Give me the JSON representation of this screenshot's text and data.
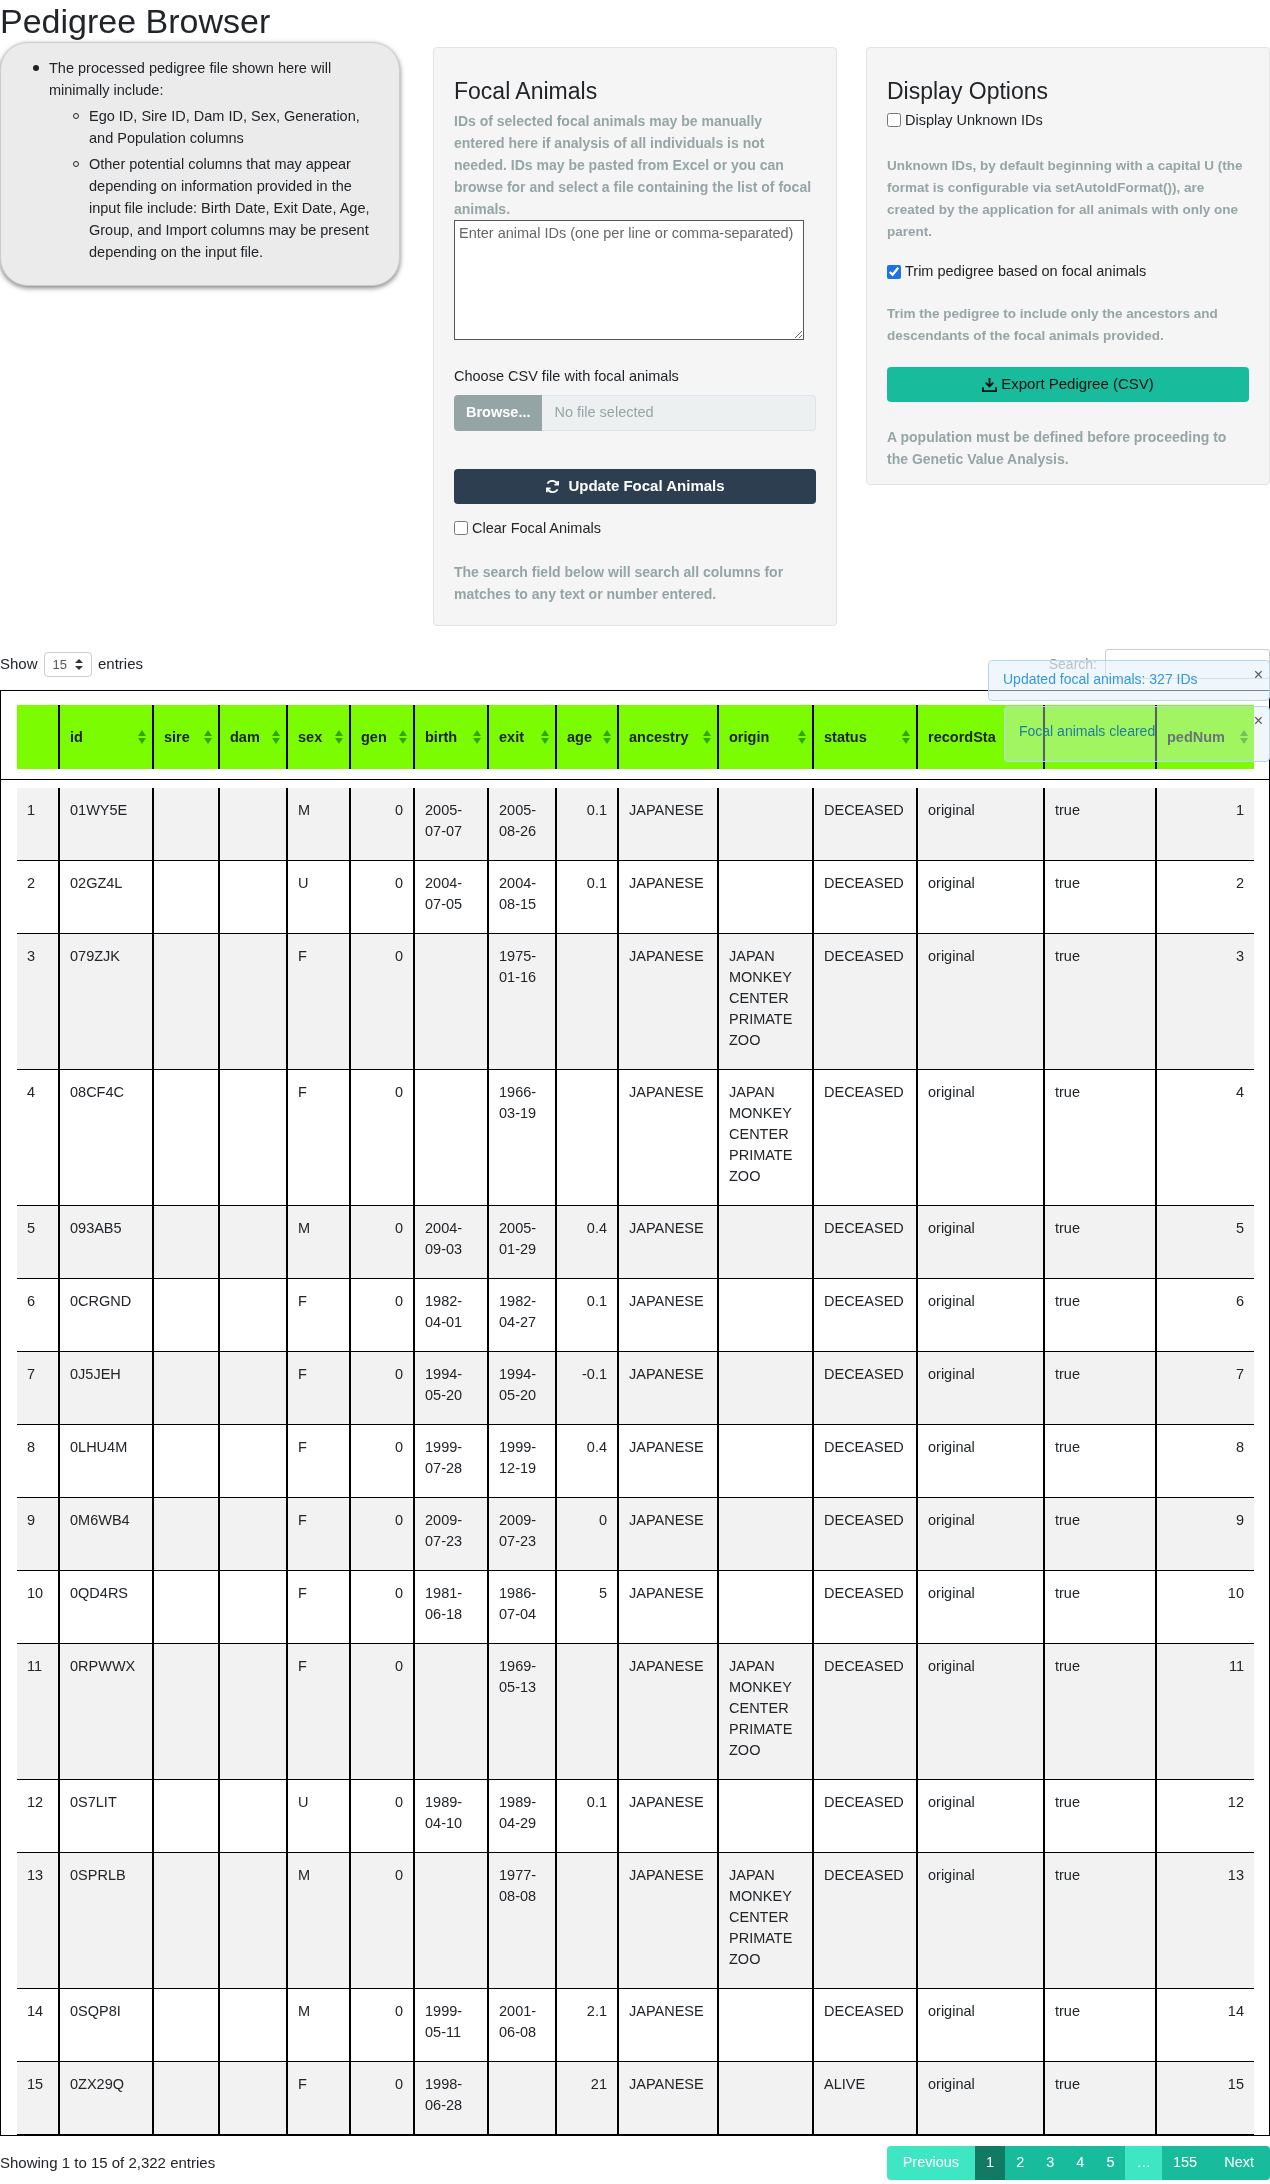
{
  "title": "Pedigree Browser",
  "info_box": {
    "items": [
      {
        "text": "The processed pedigree file shown here will minimally include:",
        "children": [
          {
            "text": "Ego ID, Sire ID, Dam ID, Sex, Generation, and Population columns"
          },
          {
            "text": "Other potential columns that may appear depending on information provided in the input file include: Birth Date, Exit Date, Age, Group, and Import columns may be present depending on the input file."
          }
        ]
      }
    ]
  },
  "focal_panel": {
    "heading": "Focal Animals",
    "help": "IDs of selected focal animals may be manually entered here if analysis of all individuals is not needed. IDs may be pasted from Excel or you can browse for and select a file containing the list of focal animals.",
    "ids_field": {
      "placeholder": "Enter animal IDs (one per line or comma-separated)"
    },
    "file_label": "Choose CSV file with focal animals",
    "browse_button": "Browse...",
    "file_field": {
      "placeholder": "No file selected"
    },
    "update_button": "Update Focal Animals",
    "clear_checkbox": {
      "label": "Clear Focal Animals",
      "checked": false
    },
    "search_note": "The search field below will search all columns for matches to any text or number entered."
  },
  "display_panel": {
    "heading": "Display Options",
    "unknown_checkbox": {
      "label": "Display Unknown IDs",
      "checked": false
    },
    "unknown_help": "Unknown IDs, by default beginning with a capital U (the format is configurable via setAutoIdFormat()), are created by the application for all animals with only one parent.",
    "trim_checkbox": {
      "label": "Trim pedigree based on focal animals",
      "checked": true
    },
    "trim_help": "Trim the pedigree to include only the ancestors and descendants of the focal animals provided.",
    "export_button": "Export Pedigree (CSV)",
    "population_note": "A population must be defined before proceeding to the Genetic Value Analysis."
  },
  "length_control": {
    "before": "Show",
    "value": "15",
    "after": "entries"
  },
  "search": {
    "label": "Search:"
  },
  "table": {
    "columns": [
      {
        "kind": "text"
      },
      {
        "label": "id",
        "kind": "text"
      },
      {
        "label": "sire",
        "kind": "text"
      },
      {
        "label": "dam",
        "kind": "text"
      },
      {
        "label": "sex",
        "kind": "text"
      },
      {
        "label": "gen",
        "kind": "number"
      },
      {
        "label": "birth",
        "kind": "text"
      },
      {
        "label": "exit",
        "kind": "text"
      },
      {
        "label": "age",
        "kind": "number"
      },
      {
        "label": "ancestry",
        "kind": "text"
      },
      {
        "label": "origin",
        "kind": "text"
      },
      {
        "label": "status",
        "kind": "text"
      },
      {
        "label": "recordSta",
        "kind": "text"
      },
      {
        "kind": "text"
      },
      {
        "label": "pedNum",
        "kind": "number"
      }
    ],
    "rows": [
      [
        "1",
        "01WY5E",
        null,
        null,
        "M",
        "0",
        "2005-07-07",
        "2005-08-26",
        "0.1",
        "JAPANESE",
        null,
        "DECEASED",
        "original",
        "true",
        "1"
      ],
      [
        "2",
        "02GZ4L",
        null,
        null,
        "U",
        "0",
        "2004-07-05",
        "2004-08-15",
        "0.1",
        "JAPANESE",
        null,
        "DECEASED",
        "original",
        "true",
        "2"
      ],
      [
        "3",
        "079ZJK",
        null,
        null,
        "F",
        "0",
        null,
        "1975-01-16",
        null,
        "JAPANESE",
        "JAPAN MONKEY CENTER PRIMATE ZOO",
        "DECEASED",
        "original",
        "true",
        "3"
      ],
      [
        "4",
        "08CF4C",
        null,
        null,
        "F",
        "0",
        null,
        "1966-03-19",
        null,
        "JAPANESE",
        "JAPAN MONKEY CENTER PRIMATE ZOO",
        "DECEASED",
        "original",
        "true",
        "4"
      ],
      [
        "5",
        "093AB5",
        null,
        null,
        "M",
        "0",
        "2004-09-03",
        "2005-01-29",
        "0.4",
        "JAPANESE",
        null,
        "DECEASED",
        "original",
        "true",
        "5"
      ],
      [
        "6",
        "0CRGND",
        null,
        null,
        "F",
        "0",
        "1982-04-01",
        "1982-04-27",
        "0.1",
        "JAPANESE",
        null,
        "DECEASED",
        "original",
        "true",
        "6"
      ],
      [
        "7",
        "0J5JEH",
        null,
        null,
        "F",
        "0",
        "1994-05-20",
        "1994-05-20",
        "-0.1",
        "JAPANESE",
        null,
        "DECEASED",
        "original",
        "true",
        "7"
      ],
      [
        "8",
        "0LHU4M",
        null,
        null,
        "F",
        "0",
        "1999-07-28",
        "1999-12-19",
        "0.4",
        "JAPANESE",
        null,
        "DECEASED",
        "original",
        "true",
        "8"
      ],
      [
        "9",
        "0M6WB4",
        null,
        null,
        "F",
        "0",
        "2009-07-23",
        "2009-07-23",
        "0",
        "JAPANESE",
        null,
        "DECEASED",
        "original",
        "true",
        "9"
      ],
      [
        "10",
        "0QD4RS",
        null,
        null,
        "F",
        "0",
        "1981-06-18",
        "1986-07-04",
        "5",
        "JAPANESE",
        null,
        "DECEASED",
        "original",
        "true",
        "10"
      ],
      [
        "11",
        "0RPWWX",
        null,
        null,
        "F",
        "0",
        null,
        "1969-05-13",
        null,
        "JAPANESE",
        "JAPAN MONKEY CENTER PRIMATE ZOO",
        "DECEASED",
        "original",
        "true",
        "11"
      ],
      [
        "12",
        "0S7LIT",
        null,
        null,
        "U",
        "0",
        "1989-04-10",
        "1989-04-29",
        "0.1",
        "JAPANESE",
        null,
        "DECEASED",
        "original",
        "true",
        "12"
      ],
      [
        "13",
        "0SPRLB",
        null,
        null,
        "M",
        "0",
        null,
        "1977-08-08",
        null,
        "JAPANESE",
        "JAPAN MONKEY CENTER PRIMATE ZOO",
        "DECEASED",
        "original",
        "true",
        "13"
      ],
      [
        "14",
        "0SQP8I",
        null,
        null,
        "M",
        "0",
        "1999-05-11",
        "2001-06-08",
        "2.1",
        "JAPANESE",
        null,
        "DECEASED",
        "original",
        "true",
        "14"
      ],
      [
        "15",
        "0ZX29Q",
        null,
        null,
        "F",
        "0",
        "1998-06-28",
        null,
        "21",
        "JAPANESE",
        null,
        "ALIVE",
        "original",
        "true",
        "15"
      ]
    ]
  },
  "info_text": "Showing 1 to 15 of 2,322 entries",
  "pagination": [
    {
      "label": "Previous",
      "kind": "nav",
      "selected": false,
      "disabled": true
    },
    {
      "label": "1",
      "kind": "page",
      "selected": true,
      "disabled": false
    },
    {
      "label": "2",
      "kind": "page",
      "selected": false,
      "disabled": false
    },
    {
      "label": "3",
      "kind": "page",
      "selected": false,
      "disabled": false
    },
    {
      "label": "4",
      "kind": "page",
      "selected": false,
      "disabled": false
    },
    {
      "label": "5",
      "kind": "page",
      "selected": false,
      "disabled": false
    },
    {
      "label": "…",
      "kind": "ellipsis",
      "selected": false,
      "disabled": true
    },
    {
      "label": "155",
      "kind": "page",
      "selected": false,
      "disabled": false
    },
    {
      "label": "Next",
      "kind": "nav",
      "selected": false,
      "disabled": false
    }
  ],
  "notifications": [
    {
      "text": "Updated focal animals: 327 IDs",
      "close": "×"
    },
    {
      "text": "Focal animals cleared",
      "close": "×"
    }
  ]
}
